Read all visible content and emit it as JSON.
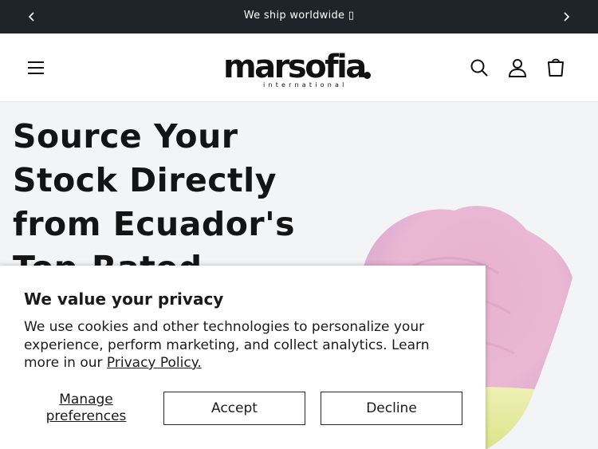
{
  "announcement": {
    "text": "We ship worldwide ",
    "emoji": "▯",
    "prev_icon": "chevron-left-icon",
    "next_icon": "chevron-right-icon"
  },
  "header": {
    "logo_word": "marsofia",
    "logo_sub": "international",
    "icons": [
      "menu-icon",
      "search-icon",
      "account-icon",
      "cart-icon"
    ]
  },
  "hero": {
    "title": "Source Your Stock Directly from Ecuador's Top-Rated"
  },
  "cookie": {
    "title": "We value your privacy",
    "body": "We use cookies and other technologies to personalize your experience, perform marketing, and collect analytics. Learn more in our ",
    "link": "Privacy Policy.",
    "manage_label": "Manage preferences",
    "accept_label": "Accept",
    "decline_label": "Decline"
  },
  "colors": {
    "announcement_bg": "#1f242b",
    "hero_bg": "#f3f4f5",
    "text": "#121212"
  }
}
